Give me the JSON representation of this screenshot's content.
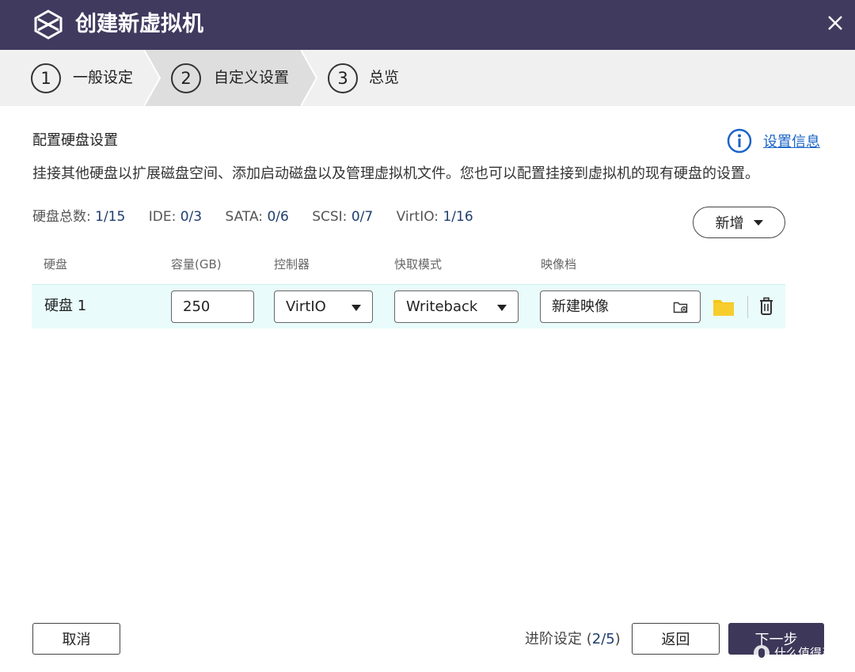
{
  "window": {
    "title": "创建新虚拟机",
    "close_icon": "close-icon"
  },
  "steps": [
    {
      "number": "1",
      "label": "一般设定"
    },
    {
      "number": "2",
      "label": "自定义设置"
    },
    {
      "number": "3",
      "label": "总览"
    }
  ],
  "section": {
    "title": "配置硬盘设置",
    "info_link": "设置信息",
    "description": "挂接其他硬盘以扩展磁盘空间、添加启动磁盘以及管理虚拟机文件。您也可以配置挂接到虚拟机的现有硬盘的设置。"
  },
  "counts": [
    {
      "label": "硬盘总数: ",
      "value": "1/15"
    },
    {
      "label": "IDE: ",
      "value": "0/3"
    },
    {
      "label": "SATA: ",
      "value": "0/6"
    },
    {
      "label": "SCSI: ",
      "value": "0/7"
    },
    {
      "label": "VirtIO: ",
      "value": "1/16"
    }
  ],
  "add_button": "新增",
  "table": {
    "headers": [
      "硬盘",
      "容量(GB)",
      "控制器",
      "快取模式",
      "映像档"
    ],
    "rows": [
      {
        "disk": "硬盘 1",
        "capacity": "250",
        "controller": "VirtIO",
        "cache_mode": "Writeback",
        "image": "新建映像"
      }
    ]
  },
  "footer": {
    "cancel": "取消",
    "advanced_label": "进阶设定 (",
    "advanced_value": "2/5",
    "advanced_suffix": ")",
    "back": "返回",
    "next": "下一步"
  },
  "watermark": "什么值得买",
  "colors": {
    "titlebar": "#403a5f",
    "link": "#1a64c8",
    "row_highlight": "#e9fbfb",
    "folder": "#f5c518",
    "primary_button": "#3d3859"
  }
}
